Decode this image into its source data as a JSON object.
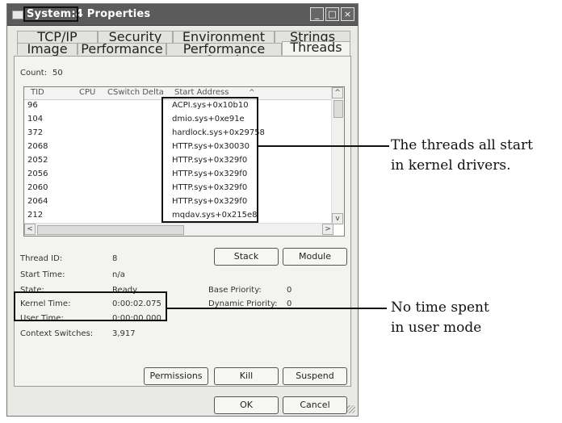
{
  "window": {
    "title": "System:4 Properties",
    "title_highlighted": "System:4",
    "title_rest": " Properties",
    "controls": {
      "minimize": "_",
      "maximize": "□",
      "close": "×"
    }
  },
  "tabs": {
    "row1": [
      "TCP/IP",
      "Security",
      "Environment",
      "Strings"
    ],
    "row2": [
      "Image",
      "Performance",
      "Performance Graph",
      "Threads"
    ],
    "active": "Threads"
  },
  "threads": {
    "count_label": "Count:",
    "count_value": "50",
    "columns": [
      "TID",
      "CPU",
      "CSwitch Delta",
      "Start Address"
    ],
    "sort_indicator": "^",
    "rows": [
      {
        "tid": "96",
        "start": "ACPI.sys+0x10b10"
      },
      {
        "tid": "104",
        "start": "dmio.sys+0xe91e"
      },
      {
        "tid": "372",
        "start": "hardlock.sys+0x29758"
      },
      {
        "tid": "2068",
        "start": "HTTP.sys+0x30030"
      },
      {
        "tid": "2052",
        "start": "HTTP.sys+0x329f0"
      },
      {
        "tid": "2056",
        "start": "HTTP.sys+0x329f0"
      },
      {
        "tid": "2060",
        "start": "HTTP.sys+0x329f0"
      },
      {
        "tid": "2064",
        "start": "HTTP.sys+0x329f0"
      },
      {
        "tid": "212",
        "start": "mqdav.sys+0x215e8"
      }
    ],
    "scroll": {
      "up": "^",
      "down": "v",
      "left": "<",
      "right": ">"
    }
  },
  "details": {
    "thread_id_label": "Thread ID:",
    "thread_id_value": "8",
    "start_time_label": "Start Time:",
    "start_time_value": "n/a",
    "state_label": "State:",
    "state_value": "Ready",
    "base_priority_label": "Base Priority:",
    "base_priority_value": "0",
    "kernel_time_label": "Kernel Time:",
    "kernel_time_value": "0:00:02.075",
    "dynamic_priority_label": "Dynamic Priority:",
    "dynamic_priority_value": "0",
    "user_time_label": "User Time:",
    "user_time_value": "0:00:00.000",
    "context_switches_label": "Context Switches:",
    "context_switches_value": "3,917"
  },
  "buttons": {
    "stack": "Stack",
    "module": "Module",
    "permissions": "Permissions",
    "kill": "Kill",
    "suspend": "Suspend",
    "ok": "OK",
    "cancel": "Cancel"
  },
  "annotations": {
    "threads_note_line1": "The threads all start",
    "threads_note_line2": "in kernel drivers.",
    "time_note_line1": "No time spent",
    "time_note_line2": "in user mode"
  }
}
